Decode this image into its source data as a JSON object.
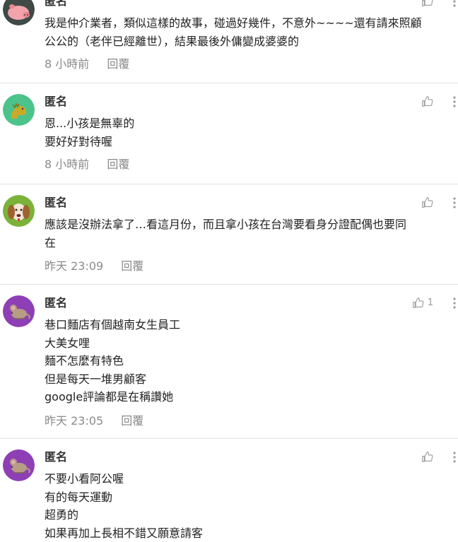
{
  "comments": [
    {
      "author": "匿名",
      "lines": [
        "我是仲介業者，類似這樣的故事，碰過好幾件，不意外~~~~還有請來照顧",
        "公公的（老伴已經離世），結果最後外傭變成婆婆的"
      ],
      "time": "8 小時前",
      "reply": "回覆",
      "likes": "",
      "avatar": "pig-avatar-icon"
    },
    {
      "author": "匿名",
      "lines": [
        "恩...小孩是無辜的",
        "要好好對待喔"
      ],
      "time": "8 小時前",
      "reply": "回覆",
      "likes": "",
      "avatar": "dragon-avatar-icon"
    },
    {
      "author": "匿名",
      "lines": [
        "應該是沒辦法拿了…看這月份，而且拿小孩在台灣要看身分證配偶也要同",
        "在"
      ],
      "time": "昨天 23:09",
      "reply": "回覆",
      "likes": "",
      "avatar": "dog-avatar-icon"
    },
    {
      "author": "匿名",
      "lines": [
        "巷口麵店有個越南女生員工",
        "大美女哩",
        "麵不怎麼有特色",
        "但是每天一堆男顧客",
        "google評論都是在稱讚她"
      ],
      "time": "昨天 23:05",
      "reply": "回覆",
      "likes": "1",
      "avatar": "rat-avatar-icon"
    },
    {
      "author": "匿名",
      "lines": [
        "不要小看阿公喔",
        "有的每天運動",
        "超勇的",
        "如果再加上長相不錯又願意請客"
      ],
      "time": "",
      "reply": "",
      "likes": "",
      "avatar": "rat-avatar-icon"
    }
  ],
  "colors": {
    "pig_bg": "#3f4a47",
    "pig": "#f2a3ab",
    "dragon_bg": "#4cc38a",
    "dragon": "#caa92a",
    "dog_bg": "#7ab23a",
    "dog": "#a0622e",
    "rat_bg": "#8e3fb6",
    "rat": "#b89c86"
  }
}
